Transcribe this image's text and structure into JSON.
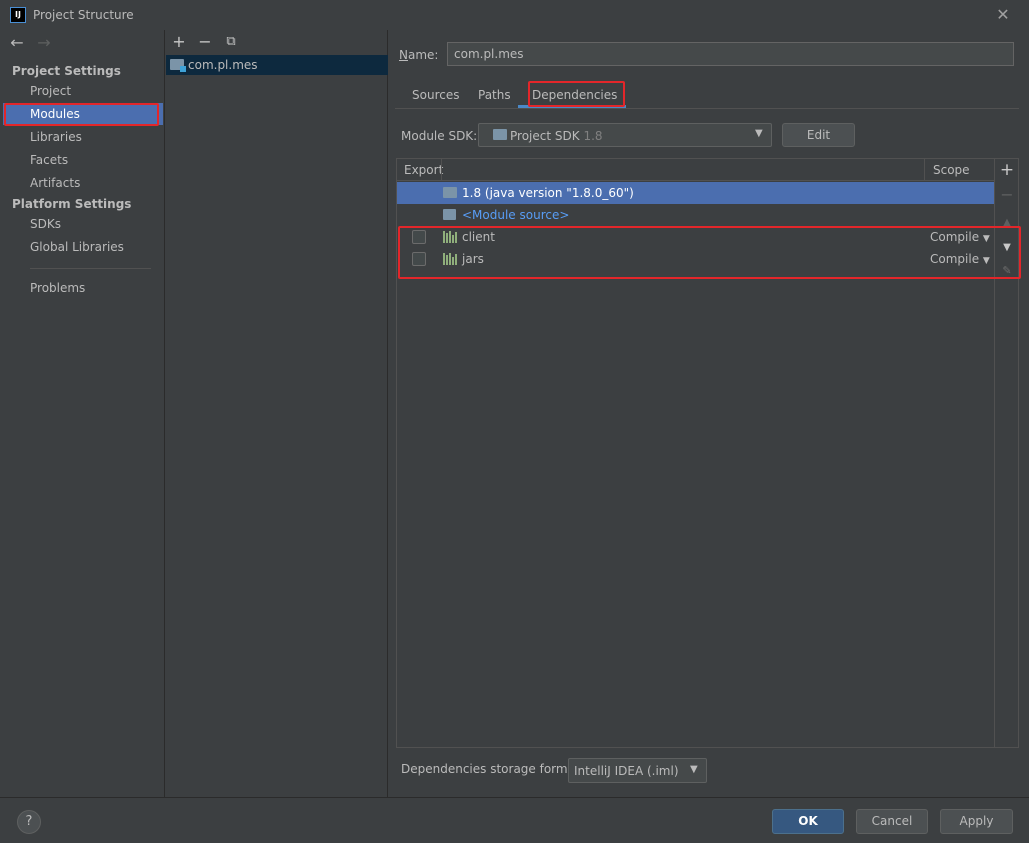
{
  "window": {
    "title": "Project Structure",
    "close_glyph": "✕"
  },
  "nav": {
    "project_settings_header": "Project Settings",
    "project_settings_items": [
      "Project",
      "Modules",
      "Libraries",
      "Facets",
      "Artifacts"
    ],
    "platform_settings_header": "Platform Settings",
    "platform_settings_items": [
      "SDKs",
      "Global Libraries"
    ],
    "extra_items": [
      "Problems"
    ],
    "selected": "Modules"
  },
  "tree": {
    "module": "com.pl.mes"
  },
  "module": {
    "name_label": "Name:",
    "name_value": "com.pl.mes",
    "tabs": [
      "Sources",
      "Paths",
      "Dependencies"
    ],
    "active_tab": "Dependencies",
    "sdk_label": "Module SDK:",
    "sdk_value": "Project SDK",
    "sdk_version": "1.8",
    "edit_button": "Edit"
  },
  "dependencies": {
    "columns": {
      "export": "Export",
      "scope": "Scope"
    },
    "rows": [
      {
        "name": "1.8 (java version \"1.8.0_60\")",
        "type": "jdk",
        "selected": true
      },
      {
        "name": "<Module source>",
        "type": "module-source"
      },
      {
        "name": "client",
        "type": "library",
        "scope": "Compile",
        "exported": false
      },
      {
        "name": "jars",
        "type": "library",
        "scope": "Compile",
        "exported": false
      }
    ]
  },
  "storage": {
    "label": "Dependencies storage format:",
    "value": "IntelliJ IDEA (.iml)"
  },
  "buttons": {
    "help": "?",
    "ok": "OK",
    "cancel": "Cancel",
    "apply": "Apply"
  },
  "colors": {
    "accent": "#4b6eaf",
    "highlight": "#e3262a",
    "background": "#3c3f41",
    "link": "#589df6"
  }
}
